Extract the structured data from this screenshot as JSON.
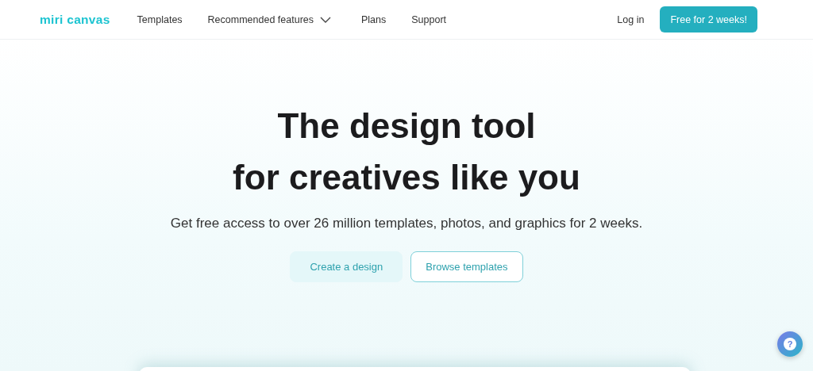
{
  "header": {
    "logo": "miri canvas",
    "nav": [
      {
        "label": "Templates",
        "kind": "link"
      },
      {
        "label": "Recommended features",
        "kind": "dropdown",
        "expanded": false
      },
      {
        "label": "Plans",
        "kind": "link"
      },
      {
        "label": "Support",
        "kind": "link"
      }
    ],
    "login": "Log in",
    "cta": "Free for 2 weeks!"
  },
  "hero": {
    "title_lines": [
      "The design tool",
      "for creatives like you"
    ],
    "subtitle": "Get free access to over 26 million templates, photos, and graphics for 2 weeks.",
    "buttons": [
      {
        "label": "Create a design",
        "kind": "filled"
      },
      {
        "label": "Browse templates",
        "kind": "outline"
      }
    ]
  },
  "help_button": {
    "label": "?"
  }
}
